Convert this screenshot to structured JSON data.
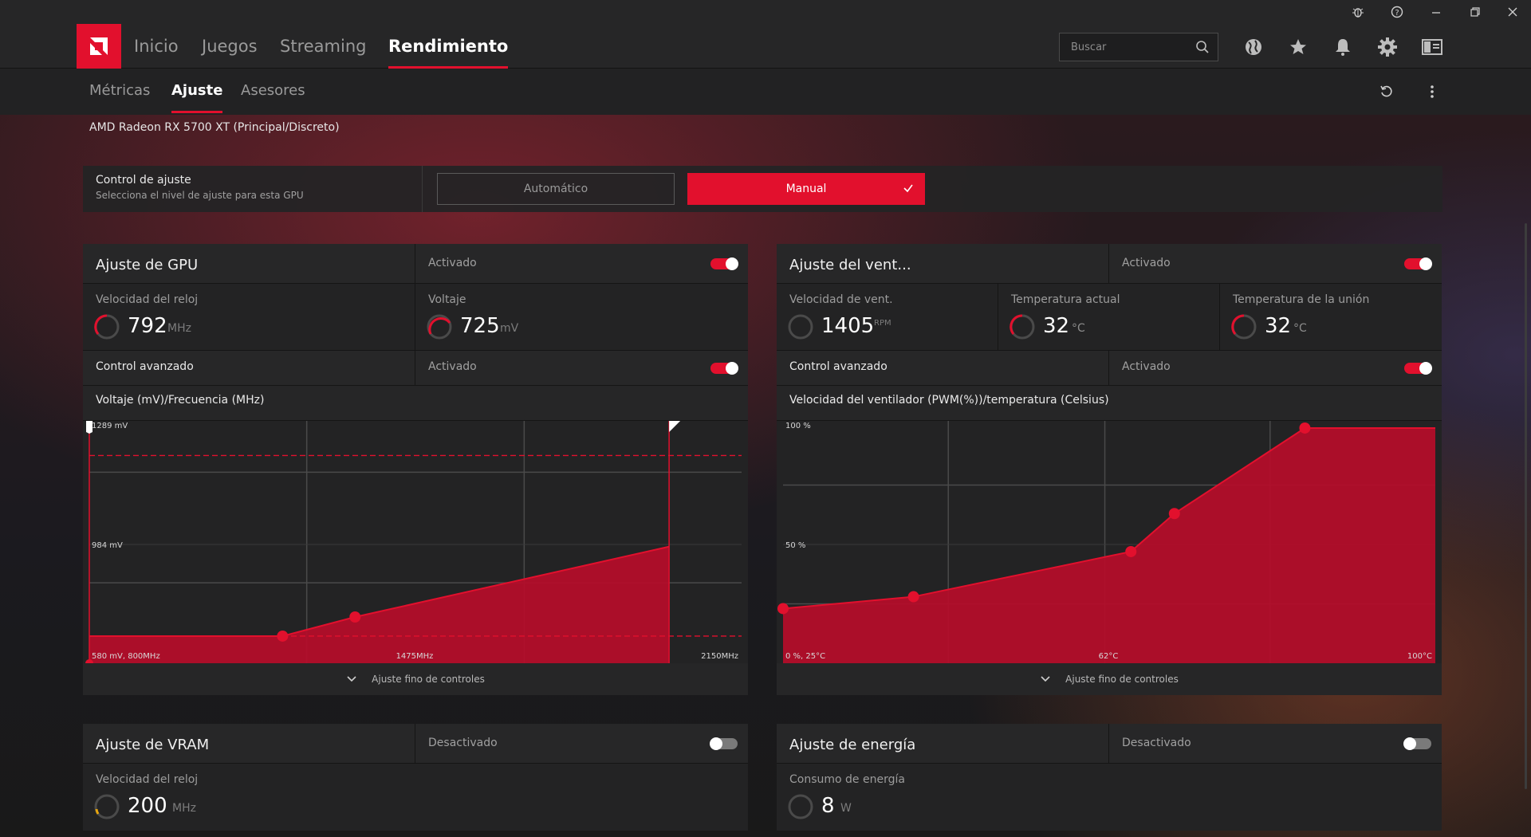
{
  "titlebar": {
    "icons": [
      "bug-icon",
      "help-icon",
      "minimize-icon",
      "restore-icon",
      "close-icon"
    ]
  },
  "nav": {
    "tabs": [
      {
        "label": "Inicio",
        "active": false
      },
      {
        "label": "Juegos",
        "active": false
      },
      {
        "label": "Streaming",
        "active": false
      },
      {
        "label": "Rendimiento",
        "active": true
      }
    ],
    "search_placeholder": "Buscar",
    "icons": [
      "globe-icon",
      "star-icon",
      "bell-icon",
      "gear-icon",
      "sidebar-layout-icon"
    ]
  },
  "subnav": {
    "tabs": [
      {
        "label": "Métricas",
        "active": false
      },
      {
        "label": "Ajuste",
        "active": true
      },
      {
        "label": "Asesores",
        "active": false
      }
    ],
    "icons": [
      "reset-icon",
      "more-vertical-icon"
    ]
  },
  "gpu_name": "AMD Radeon RX 5700 XT (Principal/Discreto)",
  "tuning_control": {
    "title": "Control de ajuste",
    "subtitle": "Selecciona el nivel de ajuste para esta GPU",
    "auto_label": "Automático",
    "manual_label": "Manual",
    "selected": "Manual"
  },
  "colors": {
    "accent": "#e2102d",
    "panel": "#1e1e1f",
    "row": "#272728"
  },
  "gpu_panel": {
    "title": "Ajuste de GPU",
    "status": "Activado",
    "enabled": true,
    "clock_label": "Velocidad del reloj",
    "clock_value": "792",
    "clock_unit": "MHz",
    "voltage_label": "Voltaje",
    "voltage_value": "725",
    "voltage_unit": "mV",
    "advanced_label": "Control avanzado",
    "advanced_status": "Activado",
    "advanced_enabled": true,
    "chart_title": "Voltaje (mV)/Frecuencia (MHz)",
    "fine_label": "Ajuste fino de controles"
  },
  "fan_panel": {
    "title": "Ajuste del vent...",
    "status": "Activado",
    "enabled": true,
    "speed_label": "Velocidad de vent.",
    "speed_value": "1405",
    "speed_unit": "RPM",
    "temp_label": "Temperatura actual",
    "temp_value": "32",
    "temp_unit": "°C",
    "junction_label": "Temperatura de la unión",
    "junction_value": "32",
    "junction_unit": "°C",
    "advanced_label": "Control avanzado",
    "advanced_status": "Activado",
    "advanced_enabled": true,
    "chart_title": "Velocidad del ventilador (PWM(%))/temperatura (Celsius)",
    "fine_label": "Ajuste fino de controles"
  },
  "vram_panel": {
    "title": "Ajuste de VRAM",
    "status": "Desactivado",
    "enabled": false,
    "clock_label": "Velocidad del reloj",
    "clock_value": "200",
    "clock_unit": "MHz"
  },
  "power_panel": {
    "title": "Ajuste de energía",
    "status": "Desactivado",
    "enabled": false,
    "power_label": "Consumo de energía",
    "power_value": "8",
    "power_unit": "W"
  },
  "chart_data": [
    {
      "type": "area",
      "title": "Voltaje (mV)/Frecuencia (MHz)",
      "x_ticks": [
        "580 mV, 800MHz",
        "1475MHz",
        "2150MHz"
      ],
      "y_ticks": [
        "1289 mV",
        "984 mV"
      ],
      "xlim": [
        800,
        2150
      ],
      "ylim": [
        580,
        1289
      ],
      "x_gridlines": [
        1250,
        1700
      ],
      "y_gridlines": [
        1150,
        820
      ],
      "limit_lines_mv": [
        1200,
        661
      ],
      "max_freq_marker": 2000,
      "points": [
        {
          "x": 800,
          "y": 661
        },
        {
          "x": 1200,
          "y": 661
        },
        {
          "x": 1350,
          "y": 718
        },
        {
          "x": 2000,
          "y": 928
        }
      ],
      "handles": [
        1,
        2
      ]
    },
    {
      "type": "area",
      "title": "Velocidad del ventilador (PWM(%))/temperatura (Celsius)",
      "x_ticks": [
        "0 %, 25°C",
        "62°C",
        "100°C"
      ],
      "y_ticks": [
        "100 %",
        "50 %"
      ],
      "xlim": [
        25,
        100
      ],
      "ylim": [
        0,
        100
      ],
      "x_gridlines": [
        44,
        62,
        81
      ],
      "y_gridlines": [
        75,
        25
      ],
      "points": [
        {
          "x": 25,
          "y": 23
        },
        {
          "x": 40,
          "y": 28
        },
        {
          "x": 65,
          "y": 47
        },
        {
          "x": 70,
          "y": 63
        },
        {
          "x": 85,
          "y": 99
        },
        {
          "x": 100,
          "y": 99
        }
      ],
      "handles": [
        0,
        1,
        2,
        3,
        4
      ]
    }
  ]
}
